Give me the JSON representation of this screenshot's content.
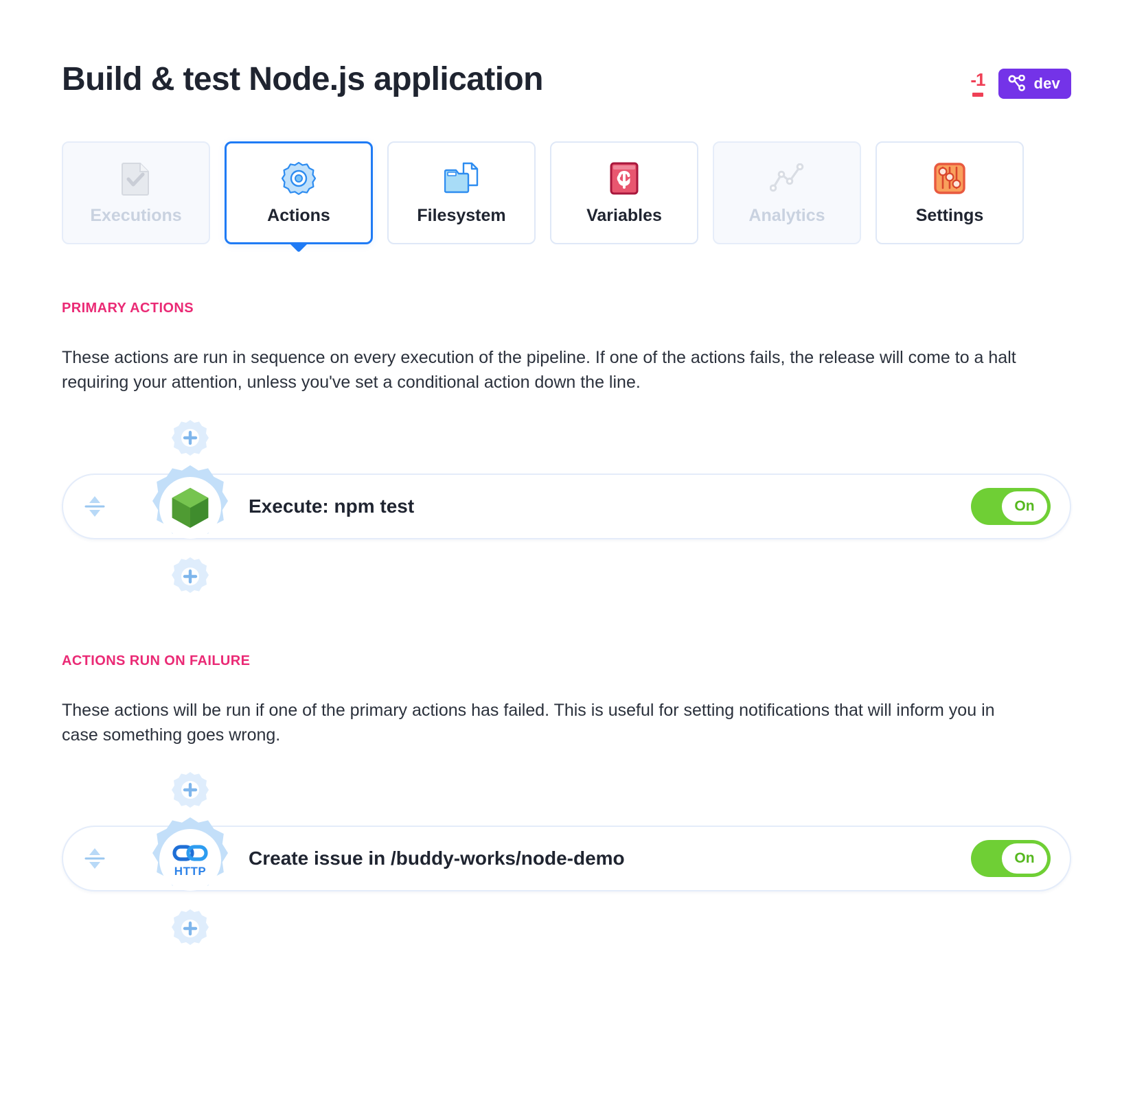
{
  "header": {
    "title": "Build & test Node.js application",
    "diff": {
      "removed": "-1",
      "bar_icon": "diff-bar"
    },
    "branch": {
      "label": "dev",
      "icon": "git-branch-icon",
      "color": "#7433e8"
    }
  },
  "tabs": [
    {
      "label": "Executions",
      "icon": "document-check-icon",
      "state": "disabled"
    },
    {
      "label": "Actions",
      "icon": "gear-icon",
      "state": "active"
    },
    {
      "label": "Filesystem",
      "icon": "folder-file-icon",
      "state": "default"
    },
    {
      "label": "Variables",
      "icon": "dollar-book-icon",
      "state": "default"
    },
    {
      "label": "Analytics",
      "icon": "line-chart-icon",
      "state": "disabled"
    },
    {
      "label": "Settings",
      "icon": "sliders-icon",
      "state": "default"
    }
  ],
  "sections": [
    {
      "heading": "PRIMARY ACTIONS",
      "description": "These actions are run in sequence on every execution of the pipeline. If one of the actions fails, the release will come to a halt requiring your attention, unless you've set a conditional action down the line.",
      "action": {
        "title": "Execute: npm test",
        "icon": "nodejs-icon",
        "toggle_label": "On",
        "toggle_state": "on",
        "drag_icon": "drag-handle-icon",
        "add_above_icon": "add-action-icon",
        "add_below_icon": "add-action-icon"
      }
    },
    {
      "heading": "ACTIONS RUN ON FAILURE",
      "description": "These actions will be run if one of the primary actions has failed. This is useful for setting notifications that will inform you in case something goes wrong.",
      "action": {
        "title": "Create issue in /buddy-works/node-demo",
        "icon": "http-link-icon",
        "icon_label": "HTTP",
        "toggle_label": "On",
        "toggle_state": "on",
        "drag_icon": "drag-handle-icon",
        "add_above_icon": "add-action-icon",
        "add_below_icon": "add-action-icon"
      }
    }
  ],
  "colors": {
    "accent_pink": "#ea2a75",
    "accent_blue": "#1f7bf5",
    "toggle_green": "#6fcf35",
    "branch_purple": "#7433e8",
    "diff_red": "#ef4056"
  }
}
